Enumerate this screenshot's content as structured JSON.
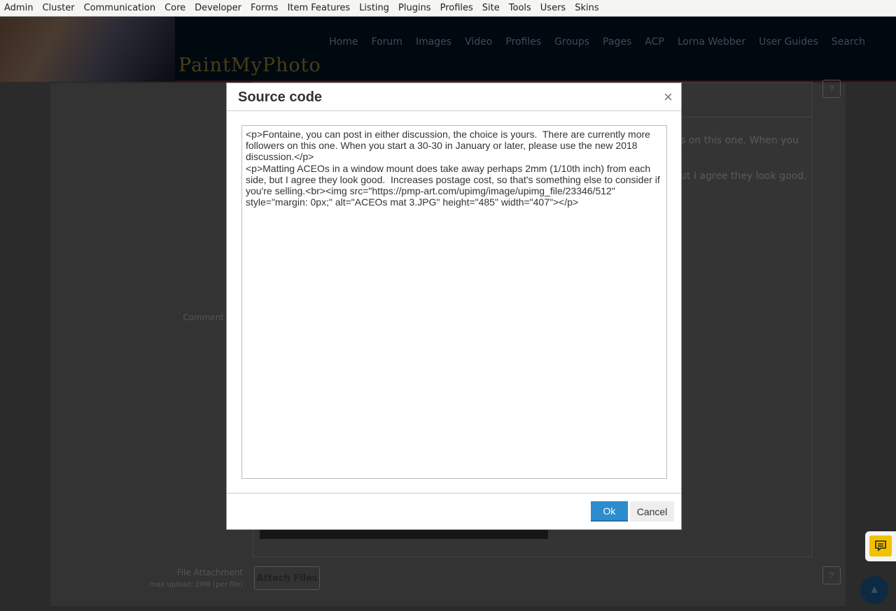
{
  "topbar": [
    "Admin",
    "Cluster",
    "Communication",
    "Core",
    "Developer",
    "Forms",
    "Item Features",
    "Listing",
    "Plugins",
    "Profiles",
    "Site",
    "Tools",
    "Users",
    "Skins"
  ],
  "header": {
    "logo": "PaintMyPhoto",
    "nav": [
      "Home",
      "Forum",
      "Images",
      "Video",
      "Profiles",
      "Groups",
      "Pages",
      "ACP",
      "Lorna Webber",
      "User Guides",
      "Search"
    ]
  },
  "background": {
    "line1": "s on this one. When you",
    "line2": "ut I agree they look good.",
    "comment_label": "Comment",
    "file_label": "File Attachment",
    "max_upload": "max upload: 2MB (per file)",
    "attach_button": "Attach Files",
    "help": "?"
  },
  "modal": {
    "title": "Source code",
    "close": "×",
    "source": "<p>Fontaine, you can post in either discussion, the choice is yours.  There are currently more followers on this one. When you start a 30-30 in January or later, please use the new 2018 discussion.</p>\n<p>Matting ACEOs in a window mount does take away perhaps 2mm (1/10th inch) from each side, but I agree they look good.  Increases postage cost, so that's something else to consider if you're selling.<br><img src=\"https://pmp-art.com/upimg/image/upimg_file/23346/512\" style=\"margin: 0px;\" alt=\"ACEOs mat 3.JPG\" height=\"485\" width=\"407\"></p>",
    "ok": "Ok",
    "cancel": "Cancel"
  }
}
